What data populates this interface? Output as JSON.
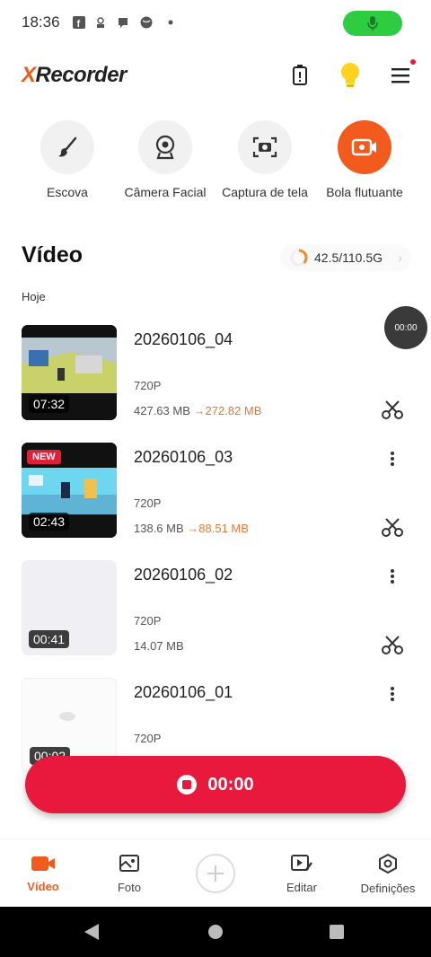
{
  "status": {
    "time": "18:36"
  },
  "app": {
    "logo_x": "X",
    "logo_rest": "Recorder"
  },
  "tools": [
    {
      "label": "Escova",
      "icon": "brush-icon"
    },
    {
      "label": "Câmera Facial",
      "icon": "webcam-icon"
    },
    {
      "label": "Captura de tela",
      "icon": "screenshot-icon"
    },
    {
      "label": "Bola flutuante",
      "icon": "floating-ball-icon"
    }
  ],
  "section": {
    "title": "Vídeo",
    "group": "Hoje"
  },
  "storage": {
    "used_total": "42.5/110.5G",
    "used_fraction": 0.38
  },
  "float_ball": {
    "time": "00:00"
  },
  "videos": [
    {
      "name": "20260106_04",
      "duration": "07:32",
      "resolution": "720P",
      "size": "427.63 MB",
      "arrow": "→",
      "compressed": "272.82 MB",
      "badge": ""
    },
    {
      "name": "20260106_03",
      "duration": "02:43",
      "resolution": "720P",
      "size": "138.6 MB",
      "arrow": "→",
      "compressed": "88.51 MB",
      "badge": "NEW"
    },
    {
      "name": "20260106_02",
      "duration": "00:41",
      "resolution": "720P",
      "size": "14.07 MB",
      "arrow": "",
      "compressed": "",
      "badge": ""
    },
    {
      "name": "20260106_01",
      "duration": "00:02",
      "resolution": "720P",
      "size": "",
      "arrow": "",
      "compressed": "",
      "badge": ""
    }
  ],
  "record": {
    "time": "00:00"
  },
  "nav": [
    {
      "label": "Vídeo",
      "active": true
    },
    {
      "label": "Foto",
      "active": false
    },
    {
      "label": "",
      "active": false
    },
    {
      "label": "Editar",
      "active": false
    },
    {
      "label": "Definições",
      "active": false
    }
  ],
  "colors": {
    "accent": "#f25a1e",
    "record": "#e8193c",
    "mic": "#2ecc40"
  }
}
